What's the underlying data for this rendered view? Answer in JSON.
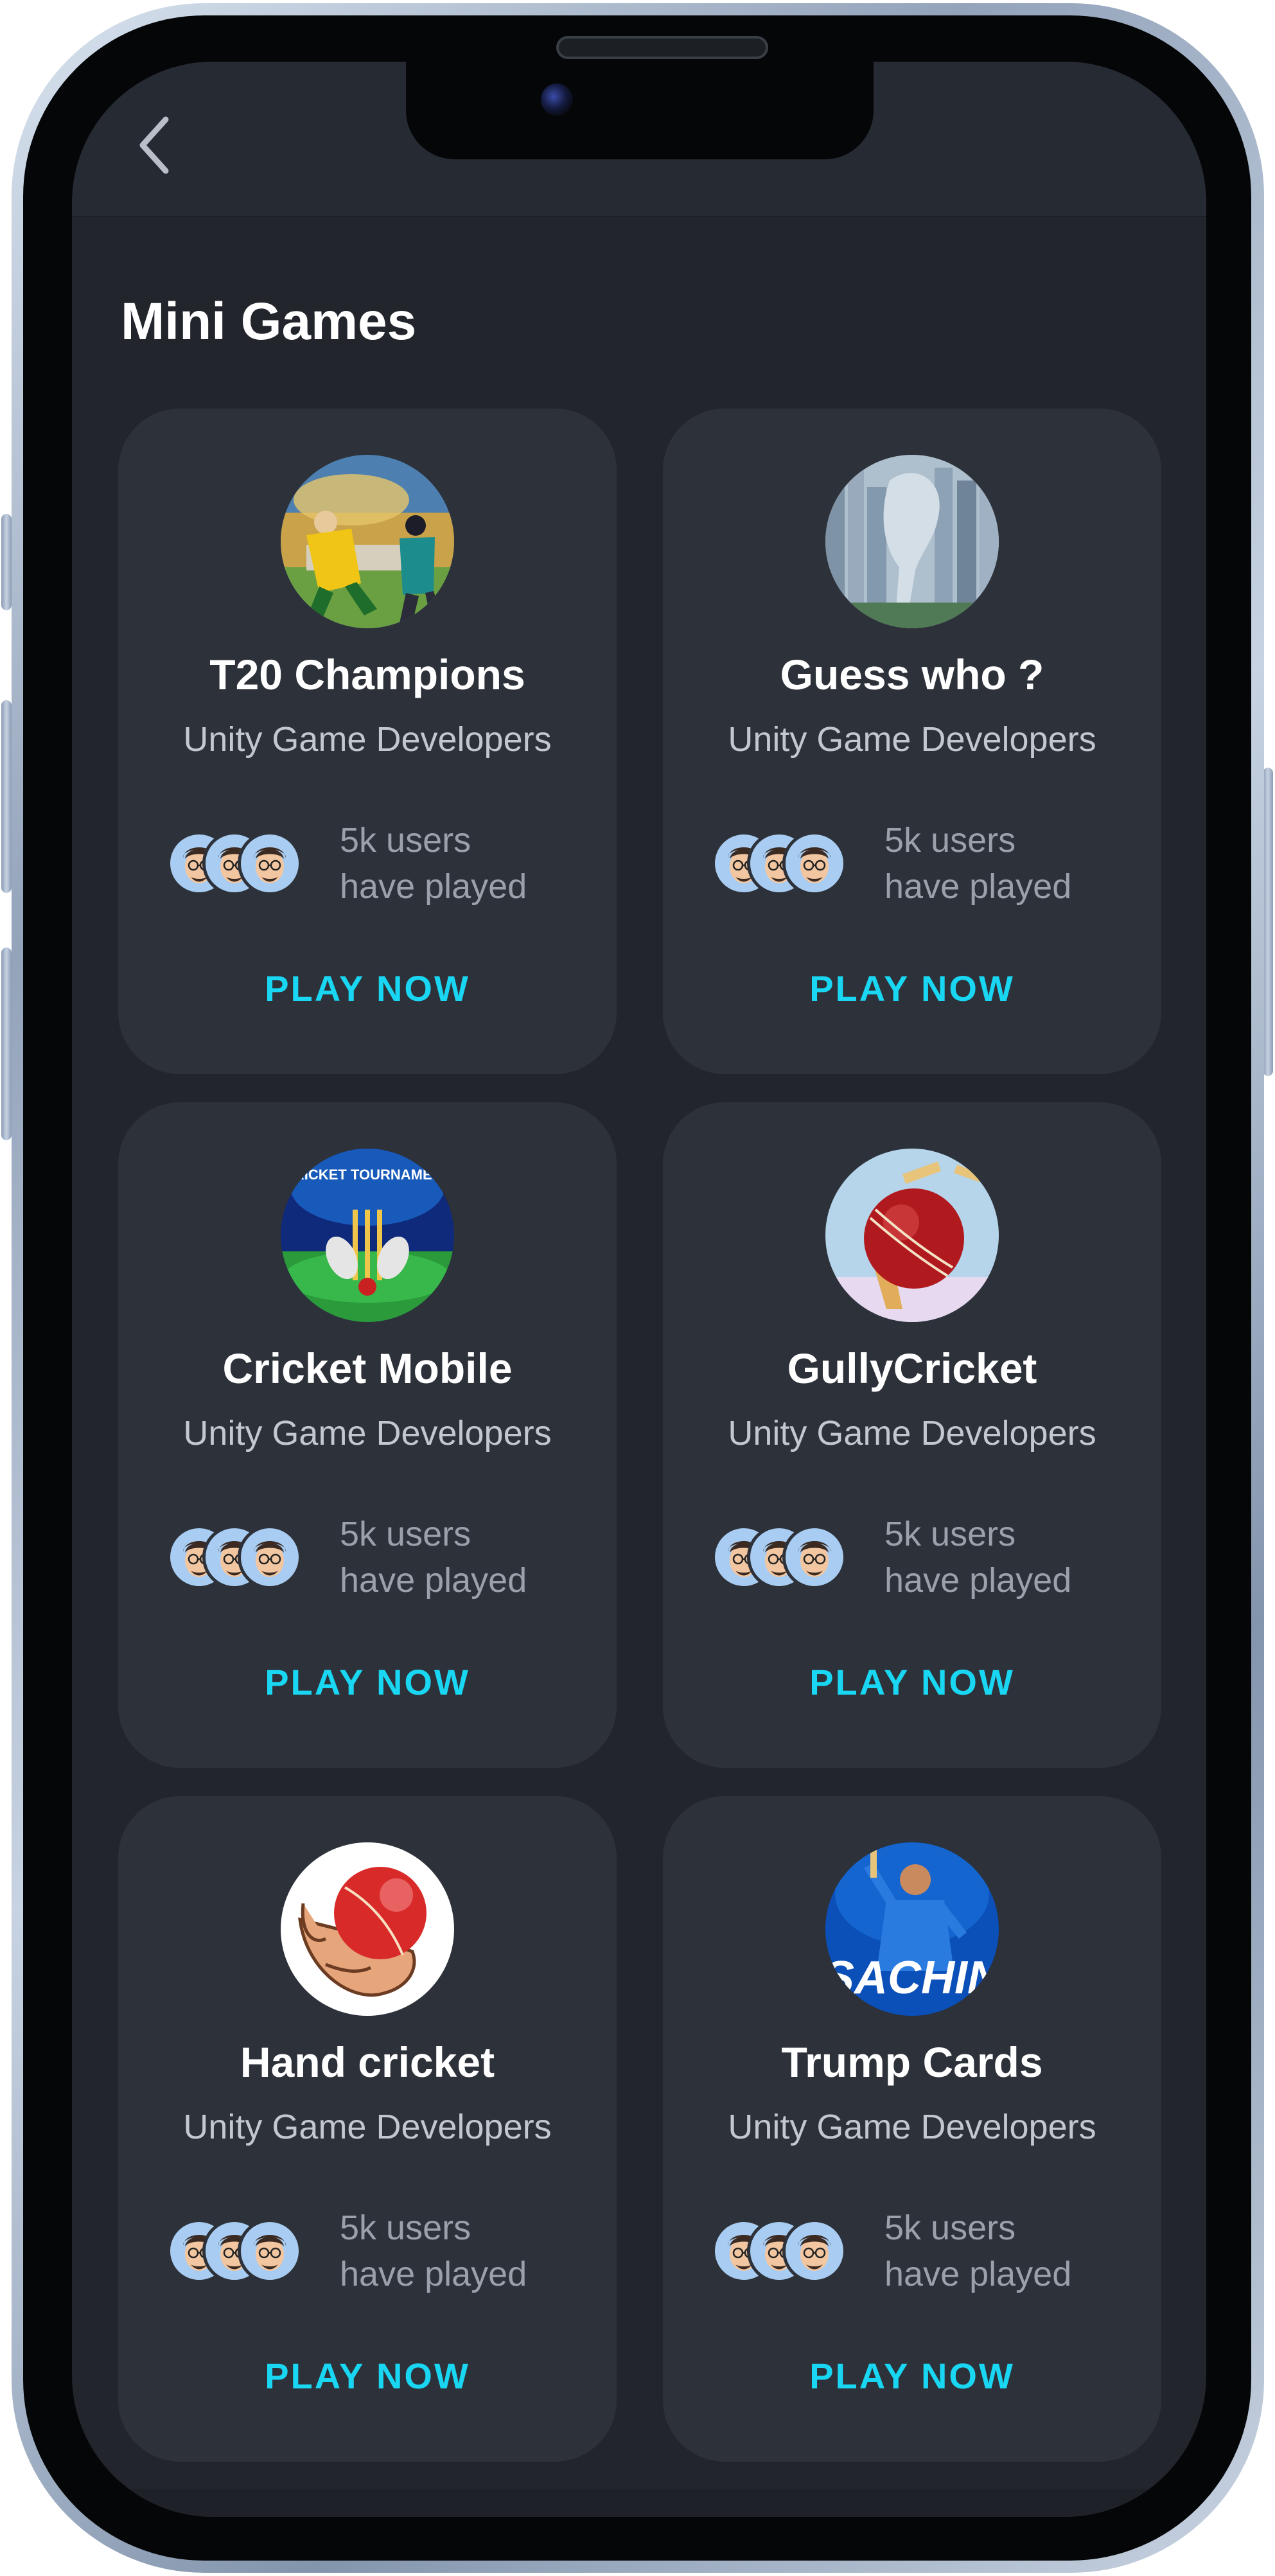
{
  "header": {
    "back_icon": "chevron-left-icon"
  },
  "page": {
    "title": "Mini Games"
  },
  "colors": {
    "background": "#22252c",
    "card": "#2d3139",
    "accent": "#19d6f2",
    "avatar": "#a9cdf2"
  },
  "games": [
    {
      "title": "T20 Champions",
      "developer": "Unity Game Developers",
      "users_line1": "5k users",
      "users_line2": "have played",
      "cta": "PLAY NOW",
      "icon": "t20-champions-thumbnail"
    },
    {
      "title": "Guess who ?",
      "developer": "Unity Game Developers",
      "users_line1": "5k users",
      "users_line2": "have played",
      "cta": "PLAY NOW",
      "icon": "guess-who-thumbnail"
    },
    {
      "title": "Cricket Mobile",
      "developer": "Unity Game Developers",
      "users_line1": "5k users",
      "users_line2": "have played",
      "cta": "PLAY NOW",
      "icon": "cricket-mobile-thumbnail",
      "thumb_caption": "CRICKET TOURNAMENT"
    },
    {
      "title": "GullyCricket",
      "developer": "Unity Game Developers",
      "users_line1": "5k users",
      "users_line2": "have played",
      "cta": "PLAY NOW",
      "icon": "gully-cricket-thumbnail"
    },
    {
      "title": "Hand cricket",
      "developer": "Unity Game Developers",
      "users_line1": "5k users",
      "users_line2": "have played",
      "cta": "PLAY NOW",
      "icon": "hand-cricket-thumbnail"
    },
    {
      "title": "Trump Cards",
      "developer": "Unity Game Developers",
      "users_line1": "5k users",
      "users_line2": "have played",
      "cta": "PLAY NOW",
      "icon": "trump-cards-thumbnail",
      "thumb_caption": "SACHIN"
    }
  ]
}
